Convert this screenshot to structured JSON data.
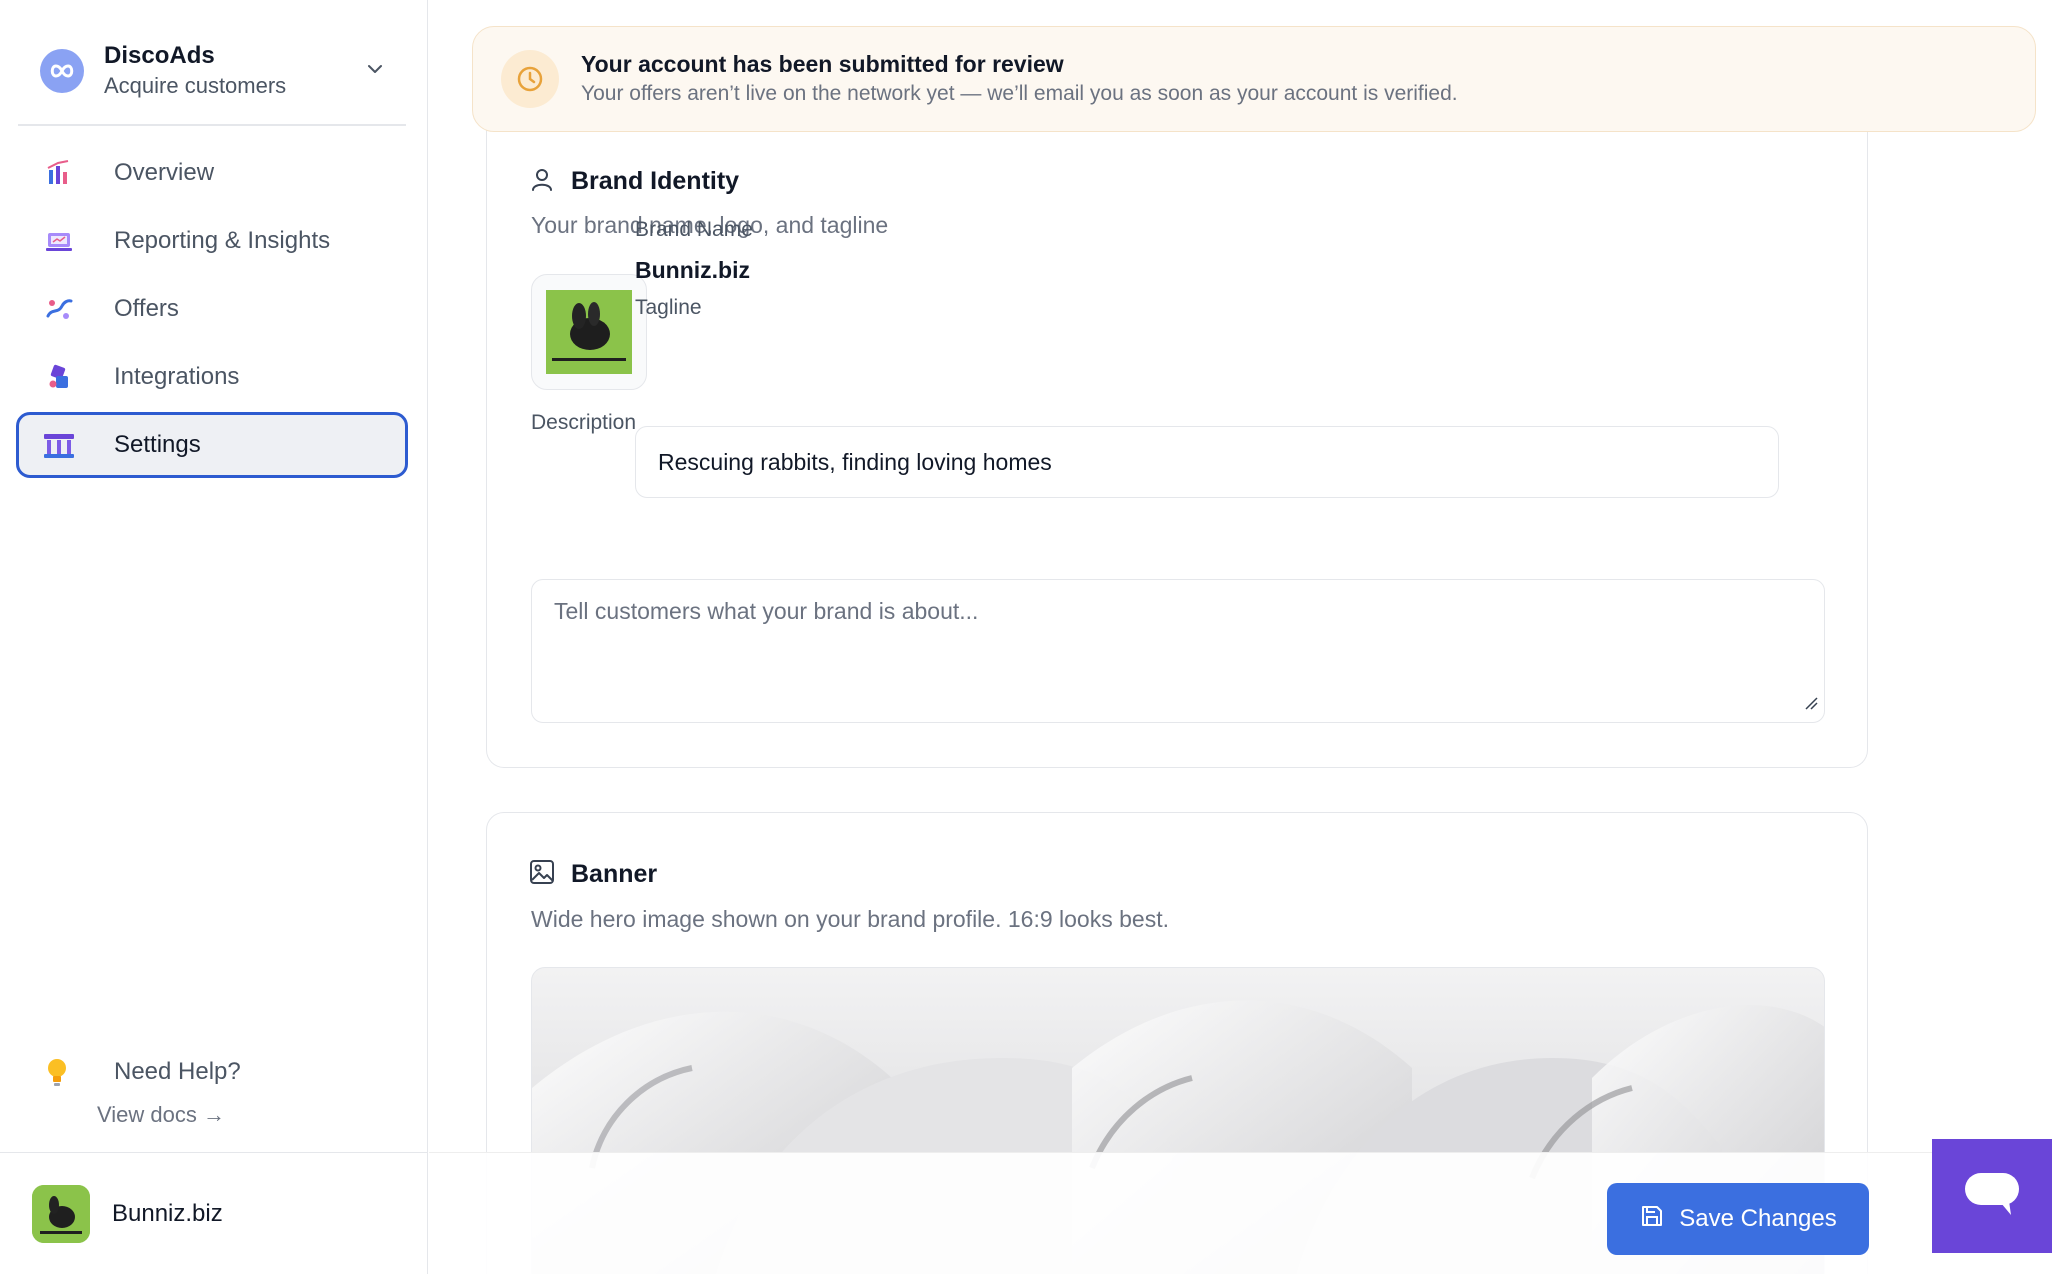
{
  "workspace": {
    "name": "DiscoAds",
    "subtitle": "Acquire customers"
  },
  "sidebar": {
    "items": [
      {
        "label": "Overview",
        "icon": "overview-icon"
      },
      {
        "label": "Reporting & Insights",
        "icon": "reporting-icon"
      },
      {
        "label": "Offers",
        "icon": "offers-icon"
      },
      {
        "label": "Integrations",
        "icon": "integrations-icon"
      },
      {
        "label": "Settings",
        "icon": "settings-icon",
        "active": true
      }
    ],
    "help_title": "Need Help?",
    "help_link": "View docs →"
  },
  "account": {
    "name": "Bunniz.biz"
  },
  "alert": {
    "title": "Your account has been submitted for review",
    "body": "Your offers aren’t live on the network yet — we’ll email you as soon as your account is verified."
  },
  "brand_identity": {
    "title": "Brand Identity",
    "subtitle": "Your brand name, logo, and tagline",
    "brand_name_label": "Brand Name",
    "brand_name_value": "Bunniz.biz",
    "tagline_label": "Tagline",
    "tagline_value": "Rescuing rabbits, finding loving homes",
    "description_label": "Description",
    "description_placeholder": "Tell customers what your brand is about..."
  },
  "banner": {
    "title": "Banner",
    "subtitle": "Wide hero image shown on your brand profile. 16:9 looks best."
  },
  "footer": {
    "save_label": "Save Changes"
  },
  "colors": {
    "accent": "#3b6fe0",
    "active_border": "#2d5bd0",
    "alert_bg": "#fdf8f1",
    "alert_icon": "#e8a23a",
    "chat": "#6a45d8"
  }
}
